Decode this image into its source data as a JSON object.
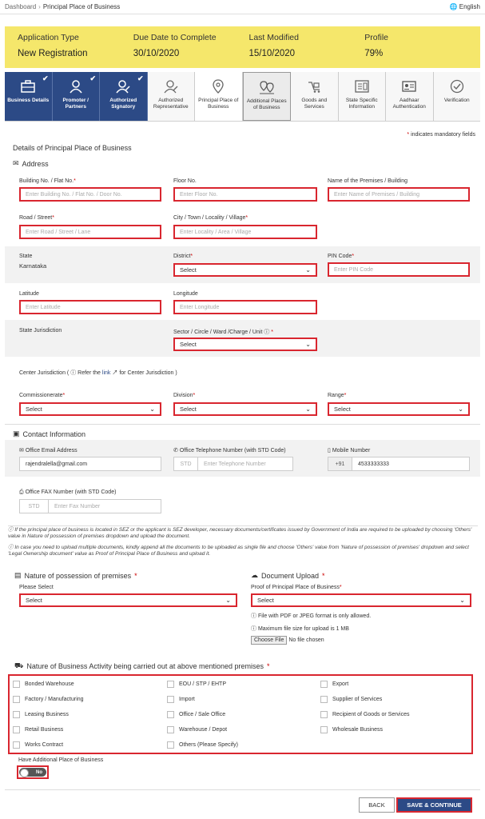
{
  "topbar": {
    "breadcrumb_home": "Dashboard",
    "breadcrumb_sep": "›",
    "breadcrumb_current": "Principal Place of Business",
    "language": "English"
  },
  "application": {
    "type_label": "Application Type",
    "type_value": "New Registration",
    "due_label": "Due Date to Complete",
    "due_value": "30/10/2020",
    "modified_label": "Last Modified",
    "modified_value": "15/10/2020",
    "profile_label": "Profile",
    "profile_value": "79%"
  },
  "steps": [
    {
      "label": "Business Details",
      "icon": "briefcase-icon",
      "state": "done"
    },
    {
      "label": "Promoter / Partners",
      "icon": "person-icon",
      "state": "done"
    },
    {
      "label": "Authorized Signatory",
      "icon": "signatory-icon",
      "state": "done"
    },
    {
      "label": "Authorized Representative",
      "icon": "representative-icon",
      "state": "pending"
    },
    {
      "label": "Principal Place of Business",
      "icon": "location-pin-icon",
      "state": "active"
    },
    {
      "label": "Additional Places of Business",
      "icon": "multi-location-icon",
      "state": "current"
    },
    {
      "label": "Goods and Services",
      "icon": "goods-icon",
      "state": "pending"
    },
    {
      "label": "State Specific Information",
      "icon": "state-info-icon",
      "state": "pending"
    },
    {
      "label": "Aadhaar Authentication",
      "icon": "id-card-icon",
      "state": "pending"
    },
    {
      "label": "Verification",
      "icon": "check-circle-icon",
      "state": "pending"
    }
  ],
  "form": {
    "mandatory_note": "indicates mandatory fields",
    "subtitle": "Details of Principal Place of Business",
    "address_heading": "Address",
    "building_label": "Building No. / Flat No.",
    "building_placeholder": "Enter Building No. / Flat No. / Door No.",
    "floor_label": "Floor No.",
    "floor_placeholder": "Enter Floor No.",
    "premises_label": "Name of the Premises / Building",
    "premises_placeholder": "Enter Name of Premises / Building",
    "road_label": "Road / Street",
    "road_placeholder": "Enter Road / Street / Lane",
    "city_label": "City / Town / Locality / Village",
    "city_placeholder": "Enter Locality / Area / Village",
    "state_label": "State",
    "state_value": "Karnataka",
    "district_label": "District",
    "district_value": "Select",
    "pin_label": "PIN Code",
    "pin_placeholder": "Enter PIN Code",
    "latitude_label": "Latitude",
    "latitude_placeholder": "Enter Latitude",
    "longitude_label": "Longitude",
    "longitude_placeholder": "Enter Longitude",
    "state_jurisdiction_label": "State Jurisdiction",
    "sector_label": "Sector / Circle / Ward /Charge / Unit",
    "sector_value": "Select",
    "center_jurisdiction_pre": "Center Jurisdiction (",
    "center_jurisdiction_mid": "Refer the",
    "center_jurisdiction_link": "link",
    "center_jurisdiction_post": "for Center Jurisdiction )",
    "commissionerate_label": "Commissionerate",
    "commissionerate_value": "Select",
    "division_label": "Division",
    "division_value": "Select",
    "range_label": "Range",
    "range_value": "Select",
    "contact_heading": "Contact Information",
    "email_label": "Office Email Address",
    "email_value": "rajendralella@gmail.com",
    "telephone_label": "Office Telephone Number (with STD Code)",
    "telephone_std": "STD",
    "telephone_placeholder": "Enter Telephone Number",
    "mobile_label": "Mobile Number",
    "mobile_prefix": "+91",
    "mobile_value": "4533333333",
    "fax_label": "Office FAX Number (with STD Code)",
    "fax_std": "STD",
    "fax_placeholder": "Enter Fax Number",
    "info_1": "If the principal place of business is located in SEZ or the applicant is SEZ developer, necessary documents/certificates issued by Government of India are required to be uploaded by choosing 'Others' value in Nature of possession of premises dropdown and upload the document.",
    "info_2": "In case you need to upload multiple documents, kindly append all the documents to be uploaded as single file and choose 'Others' value from 'Nature of possession of premises' dropdown and select 'Legal Ownership document' value as Proof of Principal Place of Business and upload it.",
    "possession_heading": "Nature of possession of premises",
    "possession_label": "Please Select",
    "possession_value": "Select",
    "upload_heading": "Document Upload",
    "proof_label": "Proof of Principal Place of Business",
    "proof_value": "Select",
    "upload_note_1": "File with PDF or JPEG format is only allowed.",
    "upload_note_2": "Maximum file size for upload is 1 MB",
    "choose_file": "Choose File",
    "no_file": "No file chosen",
    "activity_heading": "Nature of Business Activity being carried out at above mentioned premises",
    "activities": [
      "Bonded Warehouse",
      "EOU / STP / EHTP",
      "Export",
      "Factory / Manufacturing",
      "Import",
      "Supplier of Services",
      "Leasing Business",
      "Office / Sale Office",
      "Recipient of Goods or Services",
      "Retail Business",
      "Warehouse / Depot",
      "Wholesale Business",
      "Works Contract",
      "Others (Please Specify)"
    ],
    "additional_label": "Have Additional Place of Business",
    "toggle_value": "No"
  },
  "buttons": {
    "back": "BACK",
    "save": "SAVE & CONTINUE"
  },
  "colors": {
    "banner": "#f5e76b",
    "step_done": "#2c4a86",
    "error_border": "#d9262f",
    "required": "#c00"
  }
}
